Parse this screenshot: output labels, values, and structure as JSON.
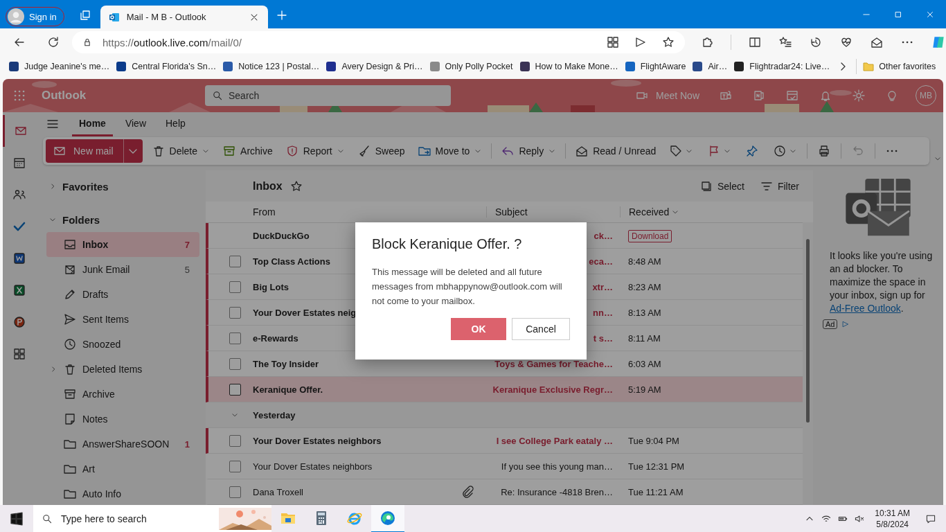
{
  "browser": {
    "sign_in": "Sign in",
    "tab_title": "Mail - M B - Outlook",
    "url_scheme": "https://",
    "url_host": "outlook.live.com",
    "url_path": "/mail/0/"
  },
  "bookmarks": [
    {
      "label": "Judge Jeanine's me…"
    },
    {
      "label": "Central Florida's Sn…"
    },
    {
      "label": "Notice 123 | Postal…"
    },
    {
      "label": "Avery Design & Pri…"
    },
    {
      "label": "Only Polly Pocket"
    },
    {
      "label": "How to Make Mone…"
    },
    {
      "label": "FlightAware"
    },
    {
      "label": "Air…"
    },
    {
      "label": "Flightradar24: Live…"
    }
  ],
  "other_favorites": "Other favorites",
  "outlook": {
    "app_name": "Outlook",
    "search_placeholder": "Search",
    "meet_now": "Meet Now",
    "avatar": "MB"
  },
  "ribbon_tabs": [
    {
      "label": "Home",
      "selected": true
    },
    {
      "label": "View",
      "selected": false
    },
    {
      "label": "Help",
      "selected": false
    }
  ],
  "toolbar": {
    "new_mail": "New mail",
    "delete": "Delete",
    "archive": "Archive",
    "report": "Report",
    "sweep": "Sweep",
    "move_to": "Move to",
    "reply": "Reply",
    "read_unread": "Read / Unread"
  },
  "folder_sections": [
    {
      "label": "Favorites",
      "expanded": false
    },
    {
      "label": "Folders",
      "expanded": true
    }
  ],
  "folders": [
    {
      "label": "Inbox",
      "count": "7",
      "count_emphasis": true,
      "selected": true,
      "has_children": false
    },
    {
      "label": "Junk Email",
      "count": "5",
      "count_emphasis": false,
      "selected": false,
      "has_children": false
    },
    {
      "label": "Drafts",
      "selected": false,
      "has_children": false
    },
    {
      "label": "Sent Items",
      "selected": false,
      "has_children": false
    },
    {
      "label": "Snoozed",
      "selected": false,
      "has_children": false
    },
    {
      "label": "Deleted Items",
      "selected": false,
      "has_children": true
    },
    {
      "label": "Archive",
      "selected": false,
      "has_children": false
    },
    {
      "label": "Notes",
      "selected": false,
      "has_children": false
    },
    {
      "label": "AnswerShareSOON",
      "count": "1",
      "count_emphasis": true,
      "selected": false,
      "has_children": false
    },
    {
      "label": "Art",
      "selected": false,
      "has_children": false
    },
    {
      "label": "Auto Info",
      "selected": false,
      "has_children": false
    }
  ],
  "message_list": {
    "title": "Inbox",
    "select": "Select",
    "filter": "Filter",
    "columns": [
      "From",
      "Subject",
      "Received"
    ]
  },
  "messages": [
    {
      "kind": "promo",
      "sender": "DuckDuckGo",
      "subject": "ck…",
      "badge": "Download",
      "unread": true,
      "selected": false,
      "attachment": false
    },
    {
      "kind": "message",
      "sender": "Top Class Actions",
      "subject": "eca…",
      "time": "8:48 AM",
      "unread": true,
      "selected": false,
      "attachment": false
    },
    {
      "kind": "message",
      "sender": "Big Lots",
      "subject": "xtr…",
      "time": "8:23 AM",
      "unread": true,
      "selected": false,
      "attachment": false
    },
    {
      "kind": "message",
      "sender": "Your Dover Estates neig",
      "subject": "nn…",
      "time": "8:13 AM",
      "unread": true,
      "selected": false,
      "attachment": false
    },
    {
      "kind": "message",
      "sender": "e-Rewards",
      "subject": "t s…",
      "time": "8:11 AM",
      "unread": true,
      "selected": false,
      "attachment": false
    },
    {
      "kind": "message",
      "sender": "The Toy Insider",
      "subject": "Toys & Games for Teache…",
      "time": "6:03 AM",
      "unread": true,
      "selected": false,
      "attachment": false
    },
    {
      "kind": "message",
      "sender": "Keranique Offer.",
      "subject": "Keranique Exclusive Regr…",
      "time": "5:19 AM",
      "unread": true,
      "selected": true,
      "attachment": false
    },
    {
      "kind": "group",
      "label": "Yesterday",
      "expanded": true
    },
    {
      "kind": "message",
      "sender": "Your Dover Estates neighbors",
      "subject": "I see College Park eataly …",
      "time": "Tue 9:04 PM",
      "unread": true,
      "selected": false,
      "attachment": false
    },
    {
      "kind": "message",
      "sender": "Your Dover Estates neighbors",
      "subject": "If you see this young man…",
      "time": "Tue 12:31 PM",
      "unread": false,
      "selected": false,
      "attachment": false
    },
    {
      "kind": "message",
      "sender": "Dana Troxell",
      "subject": "Re: Insurance -4818 Bren…",
      "time": "Tue 11:21 AM",
      "unread": false,
      "selected": false,
      "attachment": true
    }
  ],
  "ad_pane": {
    "text": "It looks like you're using an ad blocker. To maximize the space in your inbox, sign up for ",
    "link": "Ad-Free Outlook",
    "after": ".",
    "ad_label": "Ad"
  },
  "dialog": {
    "title": "Block Keranique Offer. ?",
    "body": "This message will be deleted and all future messages from mbhappynow@outlook.com will not come to your mailbox.",
    "ok": "OK",
    "cancel": "Cancel"
  },
  "taskbar": {
    "search_placeholder": "Type here to search",
    "apps": [
      {
        "kind": "folder",
        "selected": false
      },
      {
        "kind": "calculator",
        "selected": false
      },
      {
        "kind": "ie",
        "selected": false
      },
      {
        "kind": "edge",
        "selected": true
      }
    ],
    "time": "10:31 AM",
    "date": "5/8/2024"
  }
}
